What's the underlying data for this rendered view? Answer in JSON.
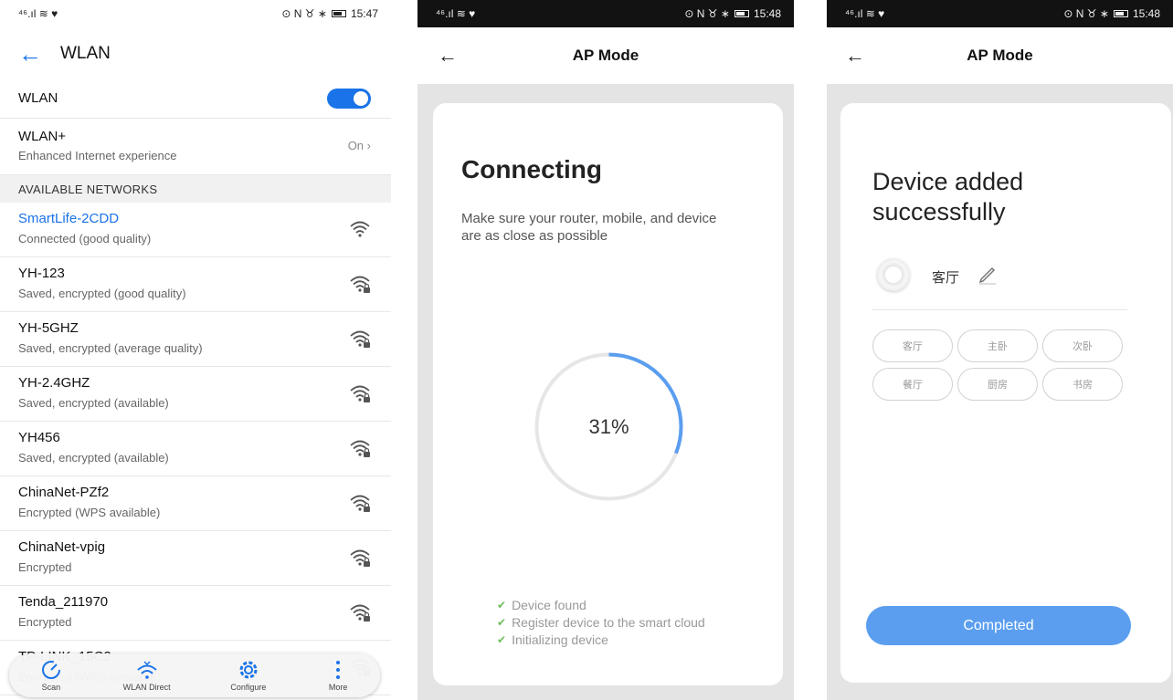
{
  "screen1": {
    "status": {
      "left": "⁴⁶.ıl ≋ ♥",
      "right": "⊙ N ♉ ∗",
      "time": "15:47"
    },
    "title": "WLAN",
    "wlan_label": "WLAN",
    "wlan_plus": {
      "title": "WLAN+",
      "subtitle": "Enhanced Internet experience",
      "value": "On"
    },
    "section": "AVAILABLE NETWORKS",
    "networks": [
      {
        "name": "SmartLife-2CDD",
        "status": "Connected (good quality)"
      },
      {
        "name": "YH-123",
        "status": "Saved, encrypted (good quality)"
      },
      {
        "name": "YH-5GHZ",
        "status": "Saved, encrypted (average quality)"
      },
      {
        "name": "YH-2.4GHZ",
        "status": "Saved, encrypted (available)"
      },
      {
        "name": "YH456",
        "status": "Saved, encrypted (available)"
      },
      {
        "name": "ChinaNet-PZf2",
        "status": "Encrypted (WPS available)"
      },
      {
        "name": "ChinaNet-vpig",
        "status": "Encrypted"
      },
      {
        "name": "Tenda_211970",
        "status": "Encrypted"
      },
      {
        "name": "TP-LINK_15C2",
        "status": "Encrypted (WPS available)"
      }
    ],
    "bottom_bar": [
      {
        "label": "Scan",
        "icon": "scan-icon"
      },
      {
        "label": "WLAN Direct",
        "icon": "wlan-direct-icon"
      },
      {
        "label": "Configure",
        "icon": "gear-icon"
      },
      {
        "label": "More",
        "icon": "more-icon"
      }
    ]
  },
  "screen2": {
    "status": {
      "left": "⁴⁶.ıl ≋ ♥",
      "right": "⊙ N ♉ ∗",
      "time": "15:48"
    },
    "back": "←",
    "title": "AP Mode",
    "heading": "Connecting",
    "description": "Make sure your router, mobile, and device are as close as possible",
    "progress": 31,
    "progress_label": "31%",
    "steps": [
      "Device found",
      "Register device to the smart cloud",
      "Initializing device"
    ],
    "colors": {
      "accent": "#5b9ef0",
      "track": "#e6e6e6",
      "check": "#6cbf5a"
    }
  },
  "screen3": {
    "status": {
      "left": "⁴⁶.ıl ≋ ♥",
      "right": "⊙ N ♉ ∗",
      "time": "15:48"
    },
    "back": "←",
    "title": "AP Mode",
    "heading": "Device added successfully",
    "device_name": "客厅",
    "rooms": [
      "客厅",
      "主卧",
      "次卧",
      "餐厅",
      "厨房",
      "书房"
    ],
    "button": "Completed",
    "colors": {
      "button": "#5b9ef0"
    }
  }
}
